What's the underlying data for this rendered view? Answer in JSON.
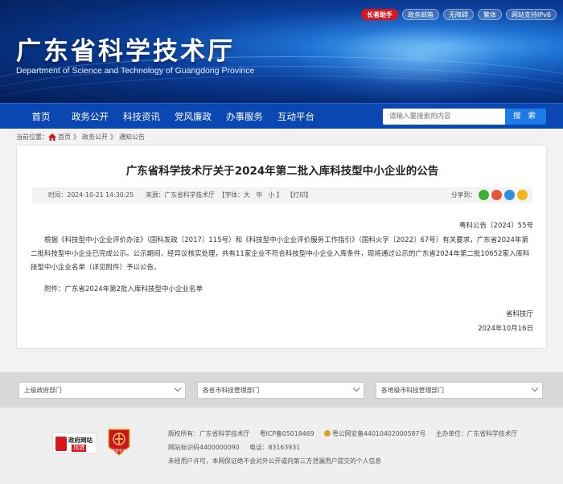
{
  "top_links": [
    "长者助手",
    "政务邮箱",
    "无障碍",
    "繁体",
    "网站支持IPv6"
  ],
  "header": {
    "title": "广东省科学技术厅",
    "subtitle": "Department of Science and Technology of Guangdong Province"
  },
  "nav": {
    "items": [
      "首页",
      "政务公开",
      "科技资讯",
      "党风廉政",
      "办事服务",
      "互动平台"
    ],
    "search_placeholder": "请输入要搜索的内容",
    "search_button": "搜 索"
  },
  "breadcrumb": {
    "prefix": "当前位置：",
    "items": [
      "首页",
      "政务公开",
      "通知公告"
    ],
    "separator": "》"
  },
  "article": {
    "title": "广东省科学技术厅关于2024年第二批入库科技型中小企业的公告",
    "meta_left": "时间：2024-10-21 14:30:25      来源：广东省科学技术厅  【字体：大   中   小 】  【打印】",
    "share_label": "分享到：",
    "doc_number": "粤科公告〔2024〕55号",
    "paragraph": "根据《科技型中小企业评价办法》（国科发政〔2017〕115号）和《科技型中小企业评价服务工作指引》（国科火字〔2022〕67号）有关要求，广东省2024年第二批科技型中小企业已完成公示。公示期间，经异议核实处理，共有11家企业不符合科技型中小企业入库条件，现将通过公示的广东省2024年第二批10652家入库科技型中小企业名单（详见附件）予以公告。",
    "attachment": "附件：广东省2024年第2批入库科技型中小企业名单",
    "signer": "省科技厅",
    "date": "2024年10月16日"
  },
  "selects": [
    "上级政府部门",
    "各省市科技管理部门",
    "各地级市科技管理部门"
  ],
  "footer": {
    "logo1_title": "政府网站",
    "logo1_sub": "找错",
    "logo2_text": "党政机关",
    "row1": [
      "版权所有：广东省科学技术厅",
      "粤ICP备05018469",
      "粤公网安备44010402000587号",
      "主办单位：广东省科学技术厅"
    ],
    "row2": [
      "网站标识码4400000090",
      "电话：83163931"
    ],
    "row3": "未经用户许可，本网保证绝不会对外公开或向第三方泄漏用户提交的个人信息"
  },
  "colors": {
    "nav_bg": "#0b47b3",
    "accent_red": "#d7161d",
    "search_button": "#1c7be6"
  }
}
